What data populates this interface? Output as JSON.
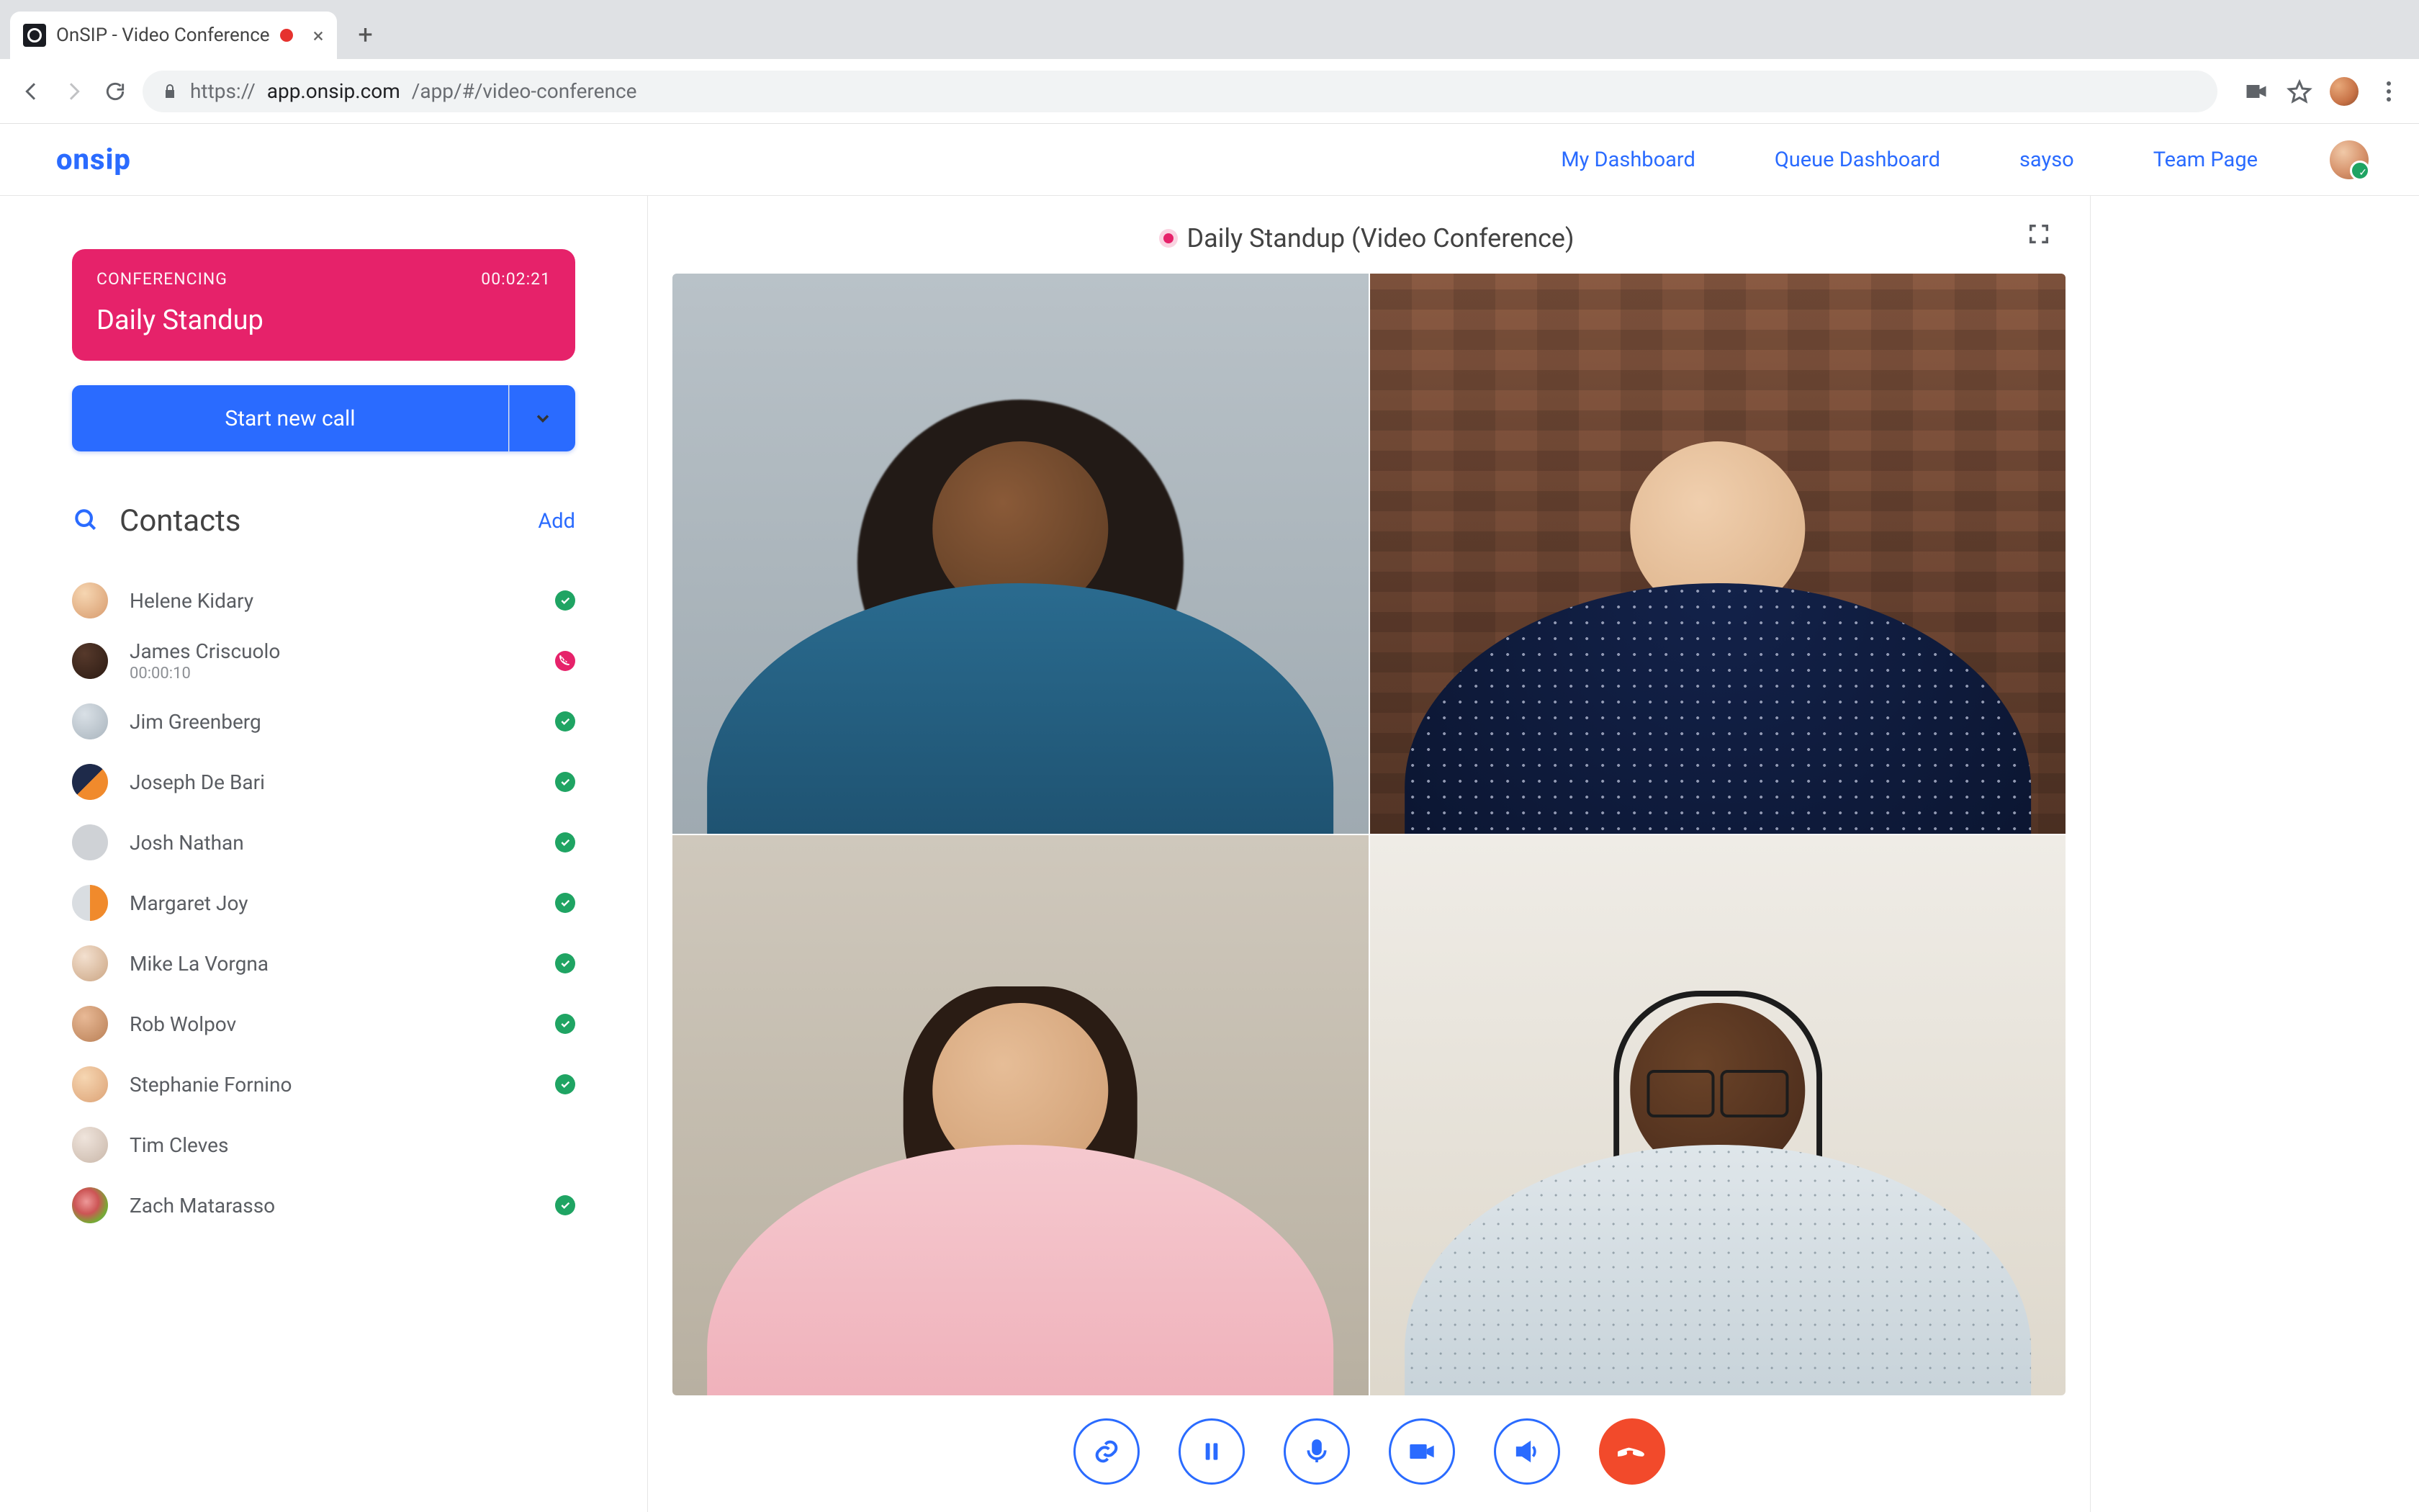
{
  "browser": {
    "tab_title": "OnSIP - Video Conference",
    "url_display_host": "app.onsip.com",
    "url_display_path": "/app/#/video-conference",
    "url_full": "https://app.onsip.com/app/#/video-conference"
  },
  "brand": {
    "name": "onsip"
  },
  "nav": {
    "links": [
      "My Dashboard",
      "Queue Dashboard",
      "sayso",
      "Team Page"
    ]
  },
  "conference_card": {
    "label": "CONFERENCING",
    "timer": "00:02:21",
    "title": "Daily Standup"
  },
  "start_call_label": "Start new call",
  "contacts_header": {
    "title": "Contacts",
    "add_label": "Add"
  },
  "contacts": [
    {
      "name": "Helene Kidary",
      "sub": "",
      "status": "available",
      "avatar": "a0"
    },
    {
      "name": "James Criscuolo",
      "sub": "00:00:10",
      "status": "oncall",
      "avatar": "a1"
    },
    {
      "name": "Jim Greenberg",
      "sub": "",
      "status": "available",
      "avatar": "a2"
    },
    {
      "name": "Joseph De Bari",
      "sub": "",
      "status": "available",
      "avatar": "a3"
    },
    {
      "name": "Josh Nathan",
      "sub": "",
      "status": "available",
      "avatar": "a4"
    },
    {
      "name": "Margaret Joy",
      "sub": "",
      "status": "available",
      "avatar": "a5"
    },
    {
      "name": "Mike La Vorgna",
      "sub": "",
      "status": "available",
      "avatar": "a6"
    },
    {
      "name": "Rob Wolpov",
      "sub": "",
      "status": "available",
      "avatar": "a7"
    },
    {
      "name": "Stephanie Fornino",
      "sub": "",
      "status": "available",
      "avatar": "a8"
    },
    {
      "name": "Tim Cleves",
      "sub": "",
      "status": "none",
      "avatar": "a9"
    },
    {
      "name": "Zach Matarasso",
      "sub": "",
      "status": "available",
      "avatar": "a10"
    }
  ],
  "meeting": {
    "title": "Daily Standup (Video Conference)"
  },
  "controls": {
    "items": [
      "link",
      "pause",
      "mic",
      "video",
      "speaker",
      "hangup"
    ]
  },
  "colors": {
    "brand_blue": "#2a6bff",
    "brand_pink": "#e6226a",
    "hangup_red": "#f24a2b",
    "presence_green": "#1fa463"
  }
}
